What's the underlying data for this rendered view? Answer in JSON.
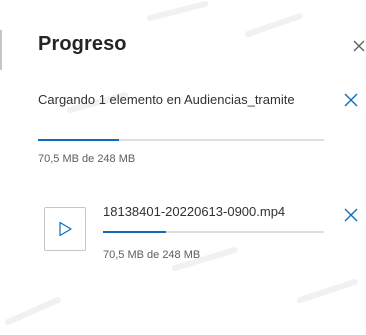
{
  "panel": {
    "title": "Progreso"
  },
  "upload": {
    "status_text": "Cargando 1 elemento en Audiencias_tramite",
    "progress_fraction": 0.284,
    "size_text": "70,5 MB de 248 MB"
  },
  "file": {
    "name": "18138401-20220613-0900.mp4",
    "progress_fraction": 0.284,
    "size_text": "70,5 MB de 248 MB",
    "icon": "play-icon"
  },
  "colors": {
    "accent": "#0f6cbd",
    "track": "#e1dfdd",
    "text": "#323130",
    "muted": "#605e5c"
  }
}
